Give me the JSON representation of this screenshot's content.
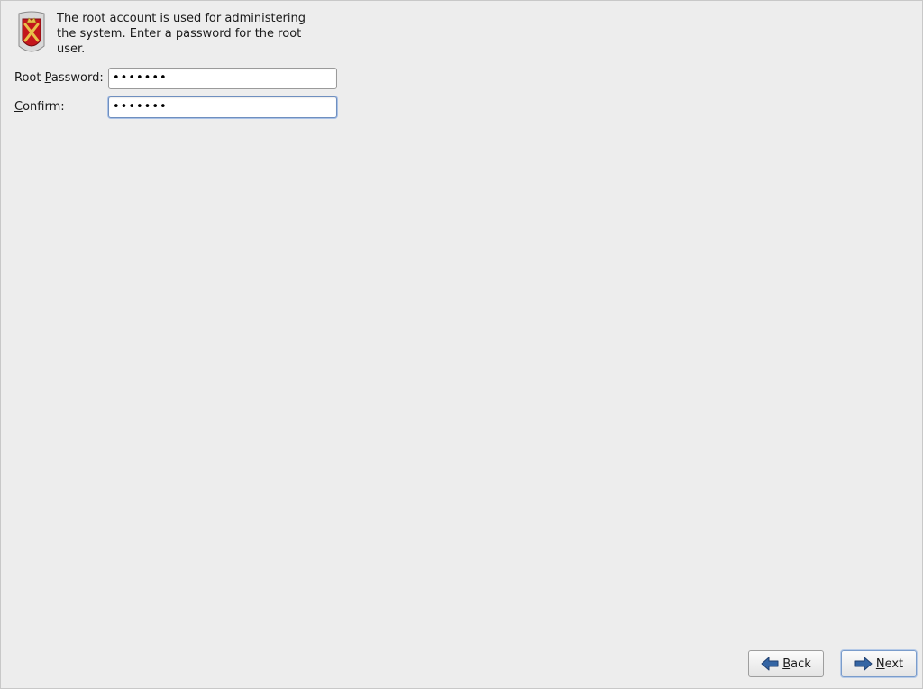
{
  "header": {
    "icon": "root-shield-icon",
    "intro_text": "The root account is used for administering the system.  Enter a password for the root user."
  },
  "form": {
    "root_password": {
      "label_pre": "Root ",
      "label_mnemonic": "P",
      "label_post": "assword:",
      "value_masked": "•••••••"
    },
    "confirm": {
      "label_pre": "",
      "label_mnemonic": "C",
      "label_post": "onfirm:",
      "value_masked": "•••••••"
    }
  },
  "buttons": {
    "back": {
      "icon": "arrow-left-icon",
      "label_mnemonic": "B",
      "label_post": "ack"
    },
    "next": {
      "icon": "arrow-right-icon",
      "label_mnemonic": "N",
      "label_post": "ext"
    }
  },
  "colors": {
    "background": "#ededed",
    "arrow_blue": "#3465a4",
    "shield_red": "#c4161c",
    "shield_gold": "#e8c04a"
  }
}
